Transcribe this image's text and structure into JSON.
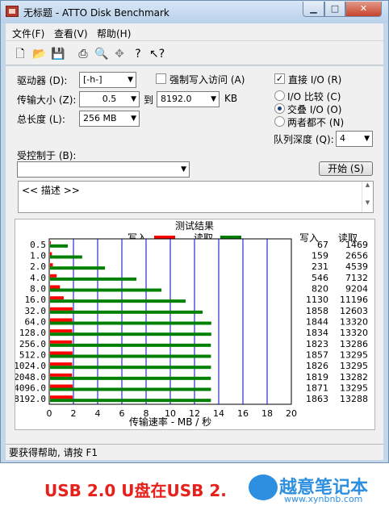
{
  "window": {
    "title": "无标题 - ATTO Disk Benchmark",
    "controls": {
      "minimize": "▁",
      "maximize": "□",
      "close": "✕"
    }
  },
  "menu": [
    "文件(F)",
    "查看(V)",
    "帮助(H)"
  ],
  "toolbar_icons": [
    "new-file-icon",
    "open-folder-icon",
    "save-icon",
    "print-icon",
    "print-preview-icon",
    "move-icon",
    "help-icon",
    "context-help-icon"
  ],
  "settings": {
    "drive_label": "驱动器 (D):",
    "drive_value": "[-h-]",
    "force_write_label": "强制写入访问 (A)",
    "direct_io_label": "直接 I/O (R)",
    "transfer_label": "传输大小 (Z):",
    "transfer_from": "0.5",
    "to_label": "到",
    "transfer_to": "8192.0",
    "unit_kb": "KB",
    "total_label": "总长度 (L):",
    "total_value": "256 MB",
    "io_compare": "I/O 比较 (C)",
    "overlap_io": "交叠 I/O (O)",
    "neither": "两者都不 (N)",
    "queue_label": "队列深度 (Q):",
    "queue_value": "4",
    "controlled_label": "受控制于 (B):",
    "controlled_value": "",
    "start_button": "开始 (S)",
    "description": "<< 描述 >>"
  },
  "results": {
    "title": "测试结果",
    "legend_write": "写入",
    "legend_read": "读取",
    "write_header": "写入",
    "read_header": "读取",
    "xlabel": "传输速率 - MB / 秒"
  },
  "chart_data": {
    "type": "bar",
    "orientation": "horizontal",
    "title": "测试结果",
    "xlabel": "传输速率 - MB / 秒",
    "xlim": [
      0,
      20
    ],
    "xticks": [
      0,
      2,
      4,
      6,
      8,
      10,
      12,
      14,
      16,
      18,
      20
    ],
    "categories": [
      "0.5",
      "1.0",
      "2.0",
      "4.0",
      "8.0",
      "16.0",
      "32.0",
      "64.0",
      "128.0",
      "256.0",
      "512.0",
      "1024.0",
      "2048.0",
      "4096.0",
      "8192.0"
    ],
    "series": [
      {
        "name": "写入",
        "color": "#ff0000",
        "values": [
          0.067,
          0.159,
          0.231,
          0.546,
          0.82,
          1.13,
          1.858,
          1.844,
          1.834,
          1.823,
          1.857,
          1.826,
          1.819,
          1.871,
          1.863
        ]
      },
      {
        "name": "读取",
        "color": "#008000",
        "values": [
          1.469,
          2.656,
          4.539,
          7.132,
          9.204,
          11.196,
          12.603,
          13.32,
          13.32,
          13.286,
          13.295,
          13.295,
          13.282,
          13.295,
          13.288
        ]
      }
    ],
    "write_column": [
      "67",
      "159",
      "231",
      "546",
      "820",
      "1130",
      "1858",
      "1844",
      "1834",
      "1823",
      "1857",
      "1826",
      "1819",
      "1871",
      "1863"
    ],
    "read_column": [
      "1469",
      "2656",
      "4539",
      "7132",
      "9204",
      "11196",
      "12603",
      "13320",
      "13320",
      "13286",
      "13295",
      "13295",
      "13282",
      "13295",
      "13288"
    ]
  },
  "status": "要获得帮助, 请按 F1",
  "caption": "USB 2.0 U盘在USB 2.",
  "watermark": {
    "text": "越意笔记本",
    "url": "www.xynbnb.com"
  }
}
